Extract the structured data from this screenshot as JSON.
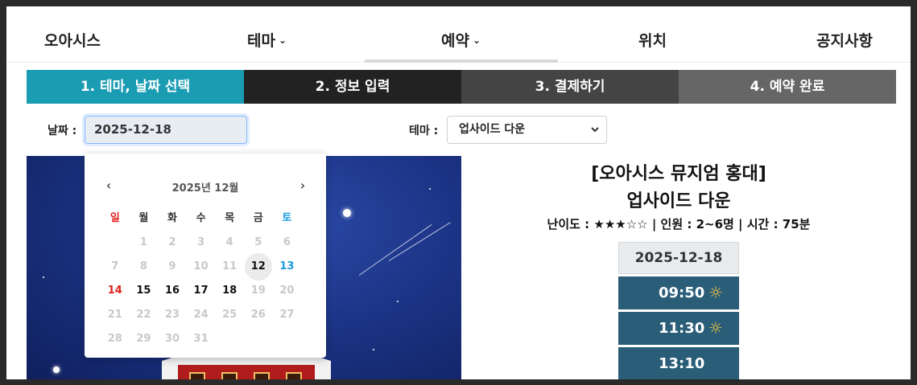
{
  "nav": {
    "items": [
      {
        "label": "오아시스",
        "chevron": false
      },
      {
        "label": "테마",
        "chevron": true
      },
      {
        "label": "예약",
        "chevron": true
      },
      {
        "label": "위치",
        "chevron": false
      },
      {
        "label": "공지사항",
        "chevron": false
      }
    ],
    "chevron_glyph": "⌄"
  },
  "steps": [
    "1. 테마, 날짜 선택",
    "2. 정보 입력",
    "3. 결제하기",
    "4. 예약 완료"
  ],
  "form": {
    "date_label": "날짜 :",
    "date_value": "2025-12-18",
    "theme_label": "테마 :",
    "theme_value": "업사이드 다운"
  },
  "calendar": {
    "title": "2025년 12월",
    "prev": "‹",
    "next": "›",
    "weekdays": [
      "일",
      "월",
      "화",
      "수",
      "목",
      "금",
      "토"
    ],
    "weeks": [
      [
        "",
        "1",
        "2",
        "3",
        "4",
        "5",
        "6"
      ],
      [
        "7",
        "8",
        "9",
        "10",
        "11",
        "12",
        "13"
      ],
      [
        "14",
        "15",
        "16",
        "17",
        "18",
        "19",
        "20"
      ],
      [
        "21",
        "22",
        "23",
        "24",
        "25",
        "26",
        "27"
      ],
      [
        "28",
        "29",
        "30",
        "31",
        "",
        "",
        ""
      ]
    ],
    "enabled_days": [
      "12",
      "13",
      "14",
      "15",
      "16",
      "17",
      "18"
    ],
    "today": "12"
  },
  "info": {
    "title_line1": "[오아시스 뮤지엄 홍대]",
    "title_line2": "업사이드 다운",
    "meta": "난이도 : ★★★☆☆ | 인원 : 2~6명 | 시간 : 75분",
    "selected_date": "2025-12-18",
    "slots": [
      {
        "time": "09:50",
        "icon": "sun-icon"
      },
      {
        "time": "11:30",
        "icon": "sun-icon"
      },
      {
        "time": "13:10",
        "icon": ""
      }
    ]
  },
  "colors": {
    "step_active": "#1a9cb3",
    "slot_bg": "#2a5d78",
    "sunday": "#e0211c",
    "saturday": "#1a9be0"
  }
}
